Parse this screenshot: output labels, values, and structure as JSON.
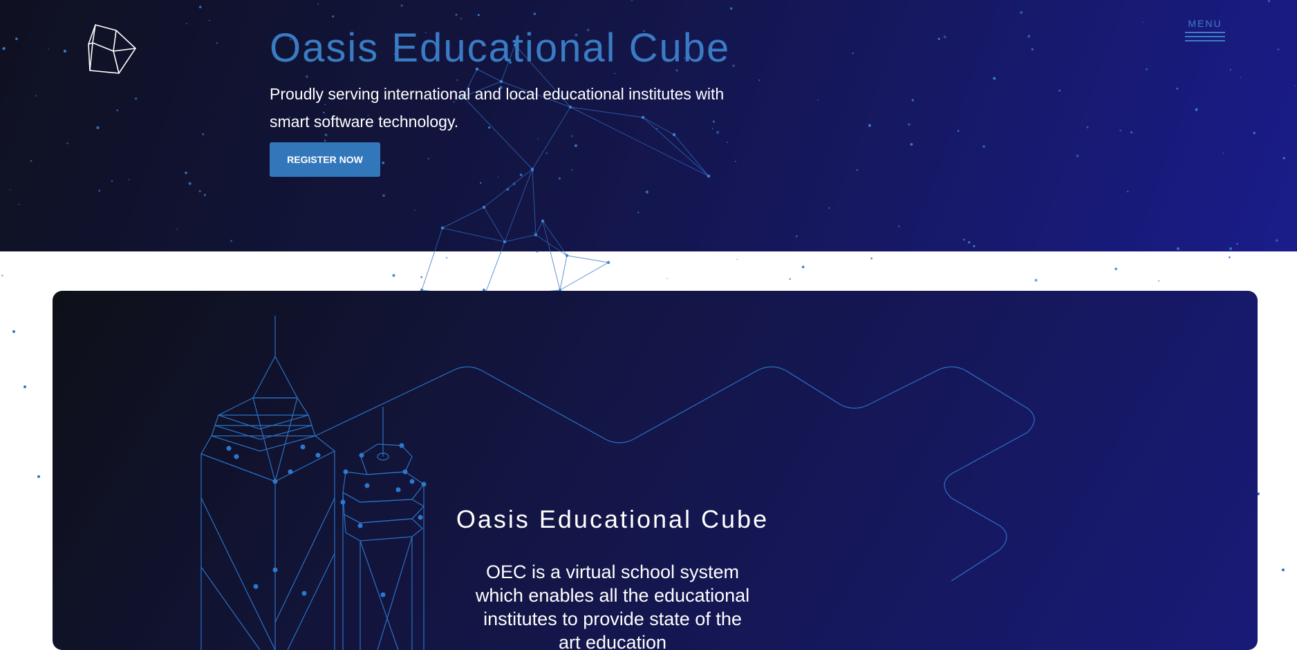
{
  "header": {
    "logo_icon": "cube-icon",
    "menu_label": "MENU",
    "menu_icon": "hamburger-icon",
    "accent_color": "#3a7cc4"
  },
  "hero": {
    "title": "Oasis Educational Cube",
    "subtitle": "Proudly serving international and local educational institutes with smart software technology.",
    "cta_label": "REGISTER NOW",
    "background_colors": [
      "#0f1121",
      "#1a1c8a"
    ]
  },
  "about": {
    "title": "Oasis Educational Cube",
    "description": "OEC is a virtual school system which enables all the educational institutes to provide state of the art education"
  }
}
